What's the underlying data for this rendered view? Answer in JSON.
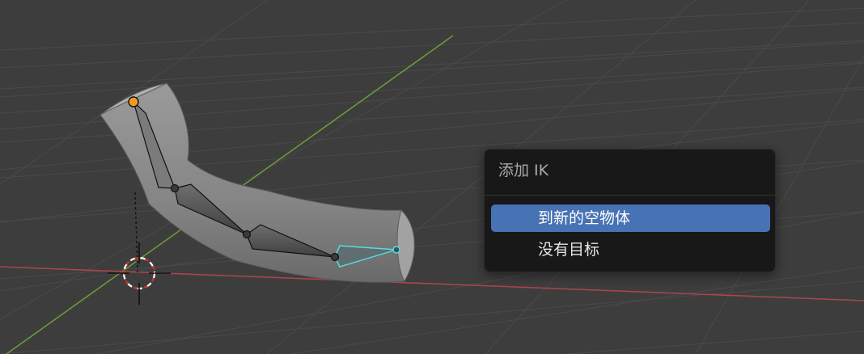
{
  "viewport": {
    "background": "#3d3d3d",
    "grid_color": "#4a4a4a",
    "x_axis_color": "#a8454f",
    "y_axis_color": "#6b9a3a",
    "mesh_color": "#8e8e8e",
    "selected_bone_color": "#55e0e6",
    "active_joint_color": "#f39a1e"
  },
  "menu": {
    "title": "添加 IK",
    "items": [
      {
        "label": "到新的空物体",
        "highlighted": true
      },
      {
        "label": "没有目标",
        "highlighted": false
      }
    ],
    "highlight_color": "#4772b3"
  }
}
